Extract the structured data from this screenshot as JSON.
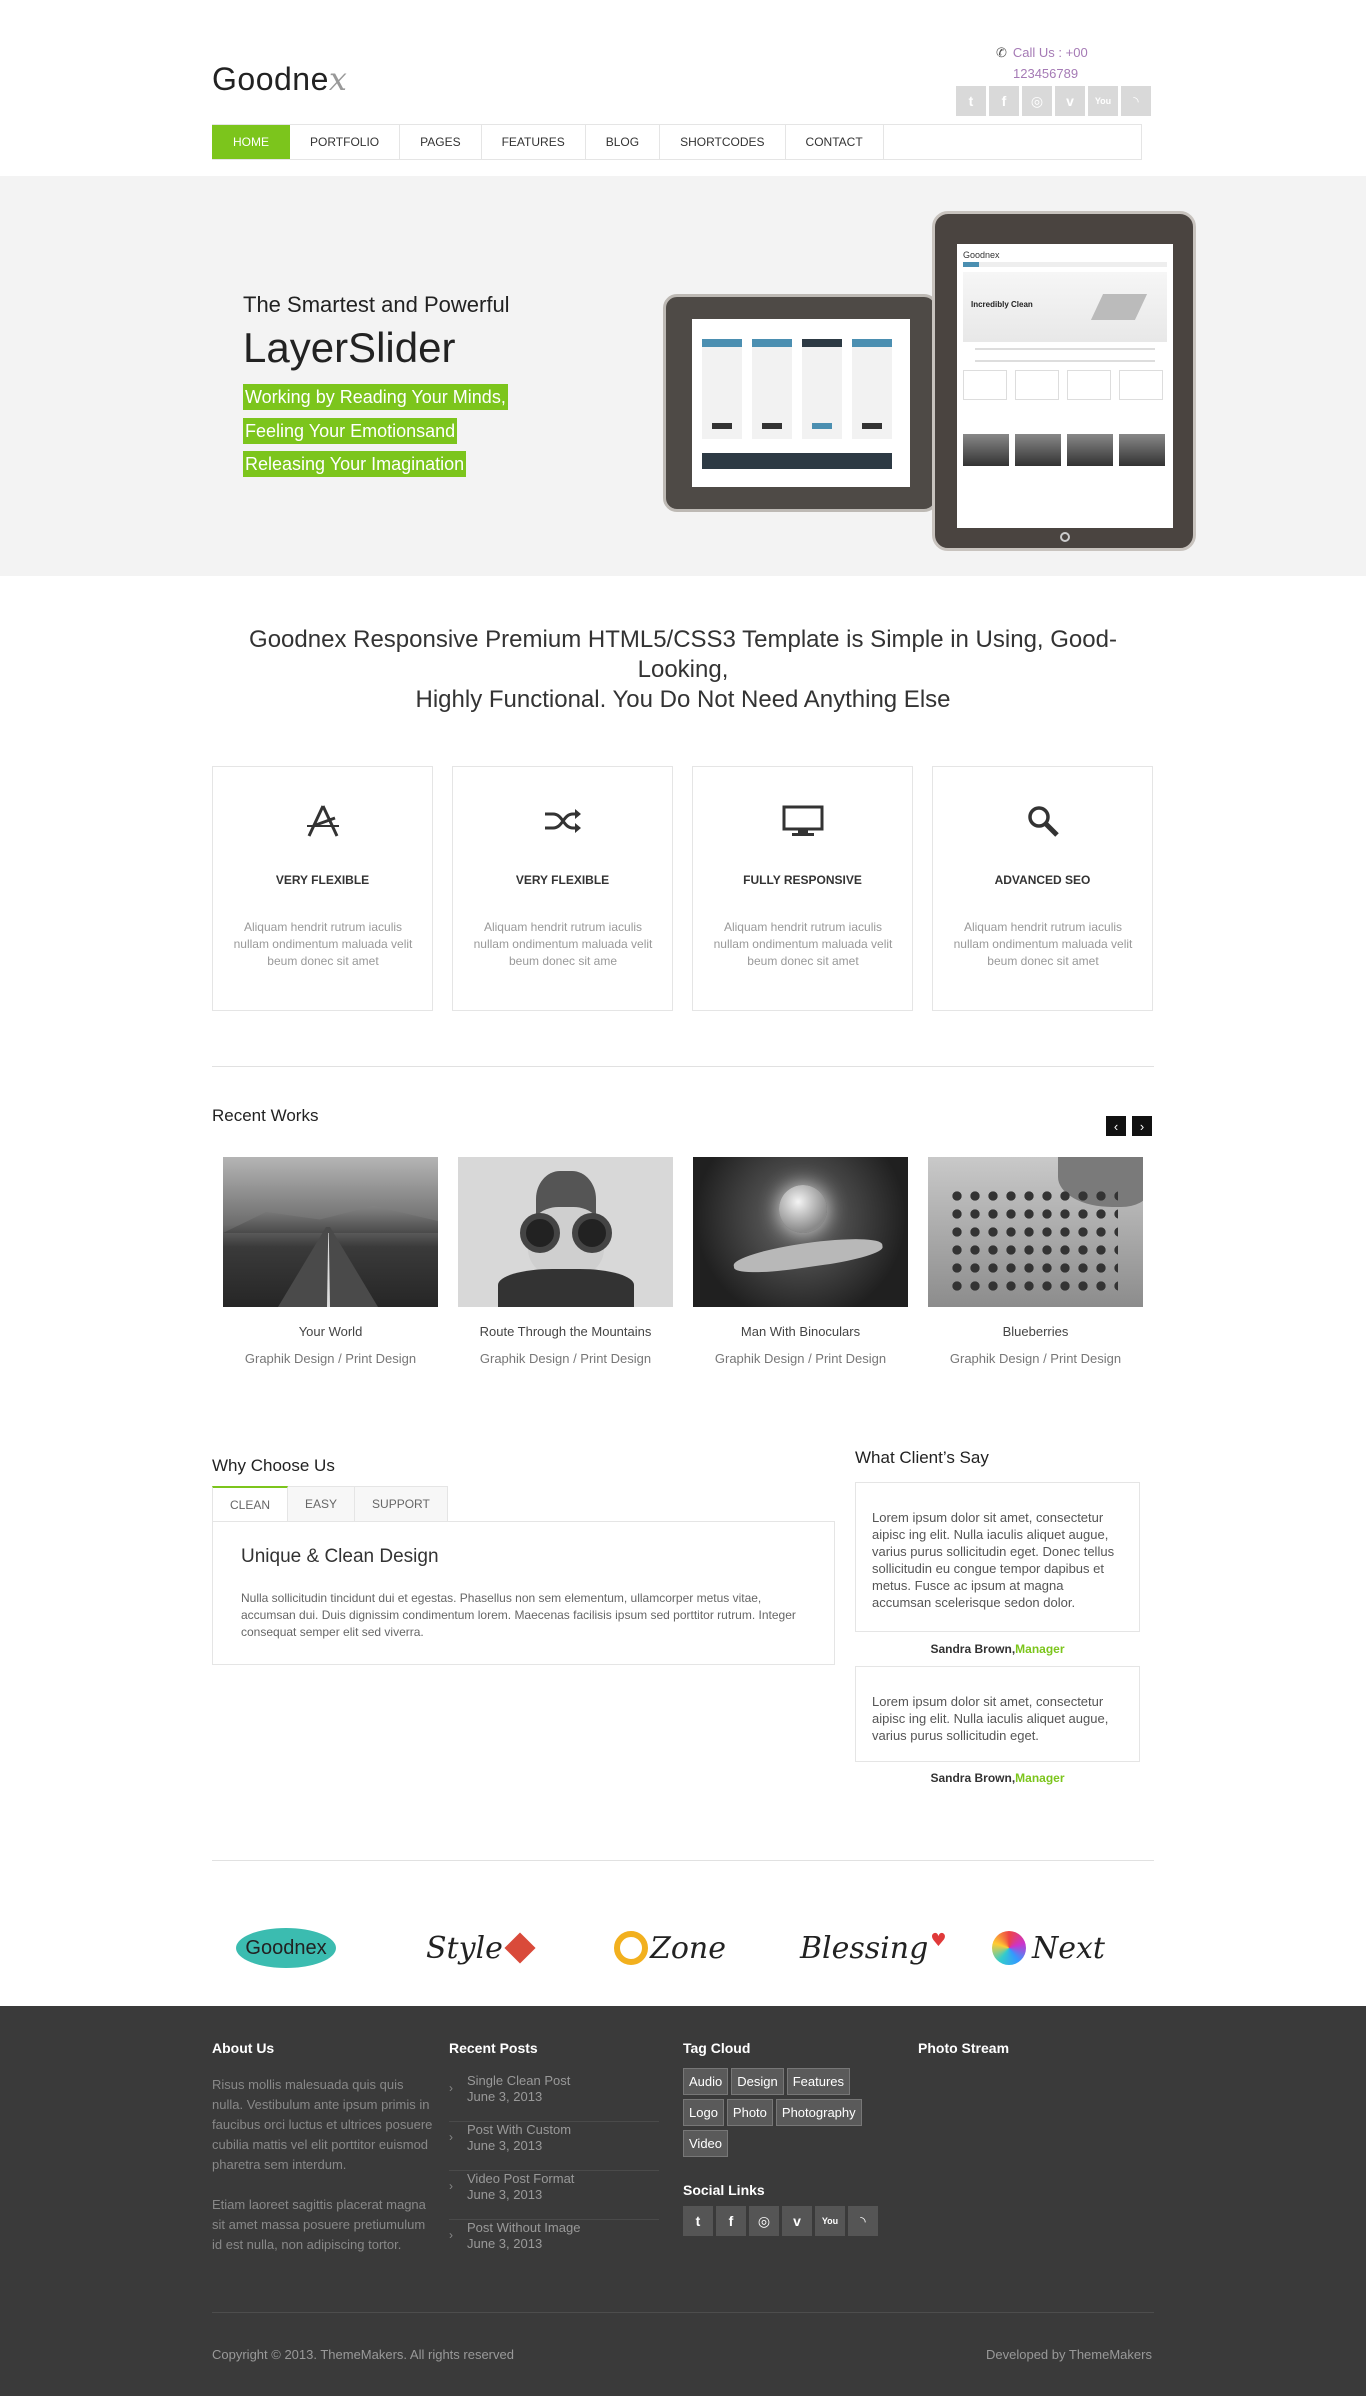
{
  "header": {
    "logo_main": "Goodne",
    "logo_x": "x",
    "call_label": "Call Us : +00",
    "call_number": "123456789",
    "social_icons": [
      "twitter-icon",
      "facebook-icon",
      "dribbble-icon",
      "vimeo-icon",
      "youtube-icon",
      "rss-icon"
    ]
  },
  "nav": {
    "items": [
      "HOME",
      "PORTFOLIO",
      "PAGES",
      "FEATURES",
      "BLOG",
      "SHORTCODES",
      "CONTACT"
    ],
    "active": "HOME"
  },
  "slider": {
    "subtitle": "The Smartest and Powerful",
    "title": "LayerSlider",
    "lines": [
      "Working by Reading Your Minds,",
      "Feeling Your Emotionsand",
      "Releasing Your Imagination"
    ],
    "tablet_logo": "Goodnex",
    "tablet_hero": "Incredibly Clean"
  },
  "intro": {
    "line1": "Goodnex Responsive Premium HTML5/CSS3 Template is Simple in Using, Good-Looking,",
    "line2": "Highly Functional. You Do Not Need Anything Else"
  },
  "features": [
    {
      "icon": "flexible-icon",
      "title": "VERY FLEXIBLE",
      "text": "Aliquam hendrit rutrum iaculis nullam ondimentum maluada velit beum donec sit amet"
    },
    {
      "icon": "shuffle-icon",
      "title": "VERY FLEXIBLE",
      "text": "Aliquam hendrit rutrum iaculis nullam ondimentum maluada velit beum donec sit ame"
    },
    {
      "icon": "monitor-icon",
      "title": "FULLY RESPONSIVE",
      "text": "Aliquam hendrit rutrum iaculis nullam ondimentum maluada velit beum donec sit amet"
    },
    {
      "icon": "search-icon",
      "title": "ADVANCED SEO",
      "text": "Aliquam hendrit rutrum iaculis nullam ondimentum maluada velit beum donec sit amet"
    }
  ],
  "recent_works": {
    "title": "Recent Works",
    "prev": "‹",
    "next": "›",
    "items": [
      {
        "title": "Your World",
        "category": "Graphik Design / Print Design"
      },
      {
        "title": "Route Through the Mountains",
        "category": "Graphik Design / Print Design"
      },
      {
        "title": "Man With Binoculars",
        "category": "Graphik Design / Print Design"
      },
      {
        "title": "Blueberries",
        "category": "Graphik Design / Print Design"
      }
    ]
  },
  "why": {
    "title": "Why Choose Us",
    "tabs": [
      "CLEAN",
      "EASY",
      "SUPPORT"
    ],
    "active_tab": "CLEAN",
    "panel_title": "Unique & Clean Design",
    "panel_text": "Nulla sollicitudin tincidunt dui et egestas. Phasellus non sem elementum, ullamcorper metus vitae, accumsan dui. Duis dignissim condimentum lorem. Maecenas facilisis ipsum sed porttitor rutrum. Integer consequat semper elit sed viverra."
  },
  "testimonials": {
    "title": "What Client’s Say",
    "items": [
      {
        "text": "Lorem ipsum dolor sit amet, consectetur aipisc ing elit. Nulla iaculis aliquet augue, varius purus sollicitudin eget. Donec tellus sollicitudin eu congue tempor dapibus et metus. Fusce ac ipsum at magna accumsan scelerisque sedon dolor.",
        "author": "Sandra Brown,",
        "role": "Manager"
      },
      {
        "text": "Lorem ipsum dolor sit amet, consectetur aipisc ing elit. Nulla iaculis aliquet augue, varius purus sollicitudin eget.",
        "author": "Sandra Brown,",
        "role": "Manager"
      }
    ]
  },
  "clients": [
    "Goodnex",
    "Style",
    "Zone",
    "Blessing",
    "Next"
  ],
  "footer": {
    "about_title": "About Us",
    "about_p1": "Risus mollis malesuada quis quis nulla. Vestibulum ante ipsum primis in faucibus orci luctus et ultrices posuere cubilia mattis vel elit porttitor euismod pharetra sem interdum.",
    "about_p2": "Etiam laoreet sagittis placerat magna sit amet massa posuere pretiumulum id est nulla, non adipiscing tortor.",
    "posts_title": "Recent Posts",
    "posts": [
      {
        "title": "Single Clean Post",
        "date": "June 3, 2013"
      },
      {
        "title": "Post With Custom",
        "date": "June 3, 2013"
      },
      {
        "title": "Video Post Format",
        "date": "June 3, 2013"
      },
      {
        "title": "Post Without Image",
        "date": "June 3, 2013"
      }
    ],
    "tags_title": "Tag Cloud",
    "tags": [
      "Audio",
      "Design",
      "Features",
      "Logo",
      "Photo",
      "Photography",
      "Video"
    ],
    "photo_title": "Photo Stream",
    "social_title": "Social Links",
    "copyright": "Copyright © 2013. ThemeMakers. All rights reserved",
    "developed": "Developed by ThemeMakers"
  },
  "colors": {
    "accent": "#7cc51c",
    "footer_bg": "#3a3a3a",
    "call": "#a57ab5"
  }
}
